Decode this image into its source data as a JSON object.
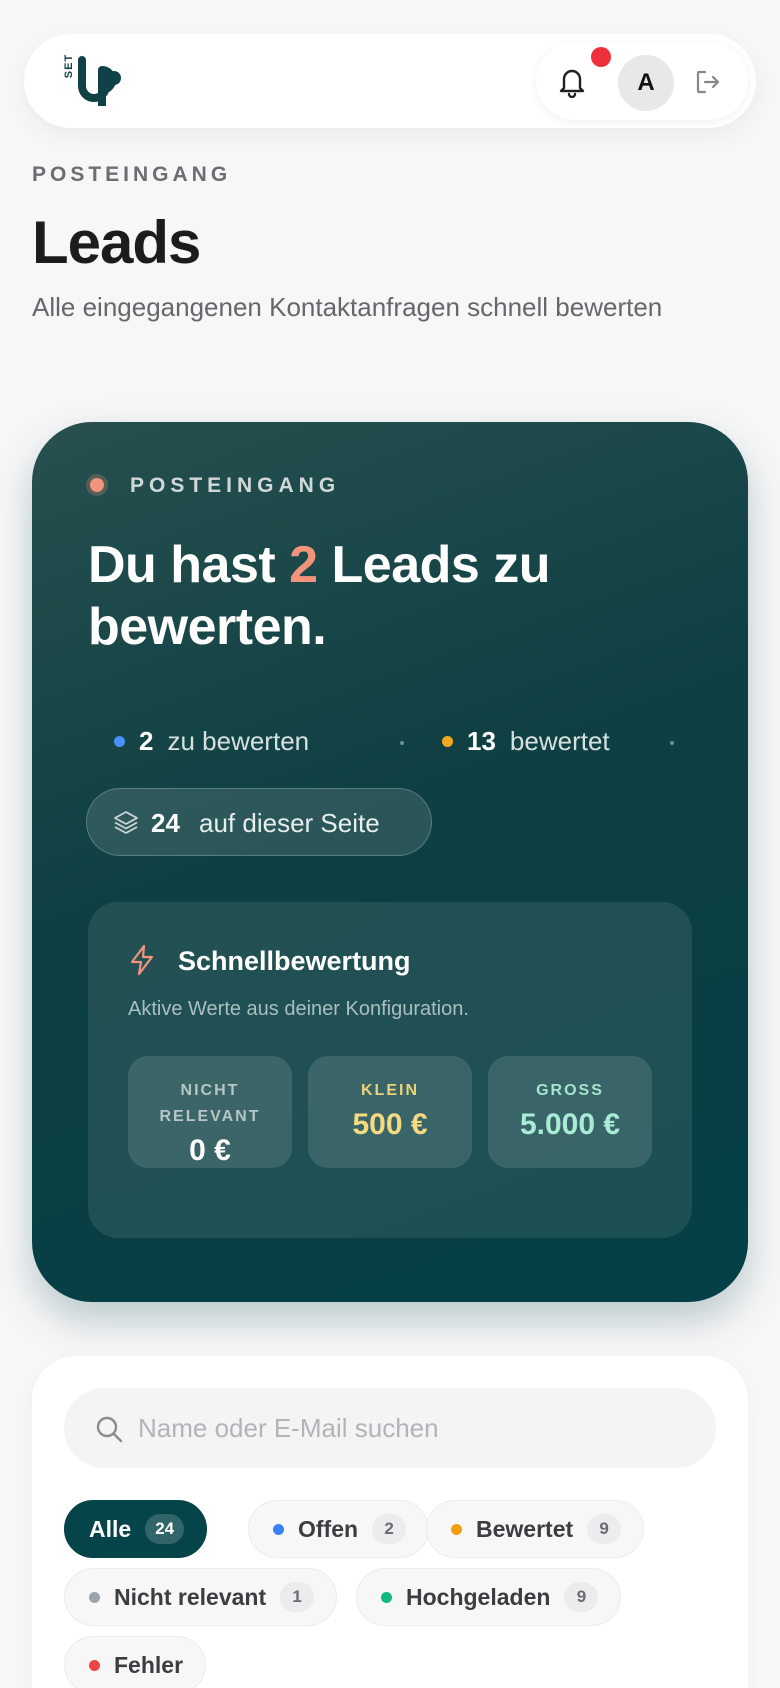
{
  "header": {
    "logo_small": "SET",
    "avatar_initial": "A",
    "icons": [
      "bell-icon",
      "logout-icon"
    ],
    "colors": {
      "notification": "#ef2f3c",
      "brand": "#0f4147"
    }
  },
  "page": {
    "eyebrow": "POSTEINGANG",
    "title": "Leads",
    "subtitle": "Alle eingegangenen Kontaktanfragen schnell bewerten"
  },
  "hero": {
    "eyebrow": "POSTEINGANG",
    "title_prefix": "Du hast ",
    "title_count": "2",
    "title_suffix": " Leads zu bewerten.",
    "stats": [
      {
        "value": "2",
        "label": "zu bewerten",
        "color": "#4a90ff"
      },
      {
        "value": "13",
        "label": "bewertet",
        "color": "#f5a623"
      }
    ],
    "page_count": {
      "value": "24",
      "label": "auf dieser Seite",
      "icon": "layers-icon"
    },
    "quick_rating": {
      "icon": "lightning-icon",
      "title": "Schnellbewertung",
      "subtitle": "Aktive Werte aus deiner Konfiguration.",
      "tiles": [
        {
          "label_line1": "NICHT",
          "label_line2": "RELEVANT",
          "value": "0 €"
        },
        {
          "label": "KLEIN",
          "value": "500 €"
        },
        {
          "label": "GROSS",
          "value": "5.000 €"
        }
      ]
    }
  },
  "list": {
    "search": {
      "placeholder": "Name oder E-Mail suchen",
      "value": ""
    },
    "filters": [
      {
        "label": "Alle",
        "count": "24",
        "active": true
      },
      {
        "label": "Offen",
        "count": "2",
        "color": "#3b82f6"
      },
      {
        "label": "Bewertet",
        "count": "9",
        "color": "#f59e0b"
      },
      {
        "label": "Nicht relevant",
        "count": "1",
        "color": "#9ca3af"
      },
      {
        "label": "Hochgeladen",
        "count": "9",
        "color": "#10b981"
      },
      {
        "label": "Fehler",
        "color": "#ef4444"
      }
    ]
  }
}
